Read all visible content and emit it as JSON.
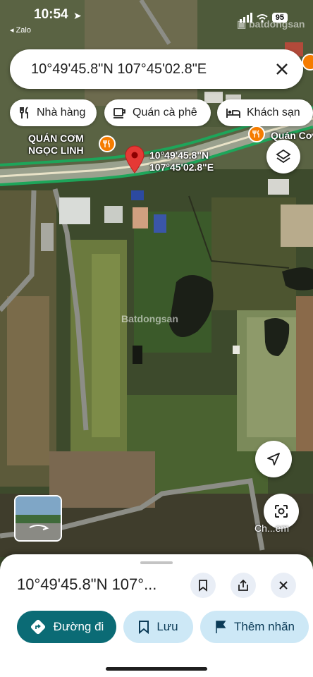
{
  "status": {
    "time": "10:54",
    "back_app": "◂ Zalo",
    "battery": "95"
  },
  "search": {
    "query": "10°49'45.8\"N 107°45'02.8\"E"
  },
  "chips": [
    {
      "label": "Nhà hàng",
      "icon": "restaurant-icon"
    },
    {
      "label": "Quán cà phê",
      "icon": "coffee-icon"
    },
    {
      "label": "Khách sạn",
      "icon": "hotel-icon"
    }
  ],
  "map": {
    "poi_left_line1": "QUÁN CƠM",
    "poi_left_line2": "NGỌC LINH",
    "poi_right": "Quán Cơ",
    "pin_lat": "10°49'45.8\"N",
    "pin_lng": "107°45'02.8\"E",
    "watermark": "Batdongsan",
    "lens_label": "Ch...em"
  },
  "sheet": {
    "title": "10°49'45.8\"N 107°...",
    "actions": {
      "directions": "Đường đi",
      "save": "Lưu",
      "add_label": "Thêm nhãn"
    }
  },
  "colors": {
    "primary": "#0b6b75",
    "chip_bg": "#cde8f6",
    "pin": "#e53935",
    "poi": "#f57c00"
  }
}
